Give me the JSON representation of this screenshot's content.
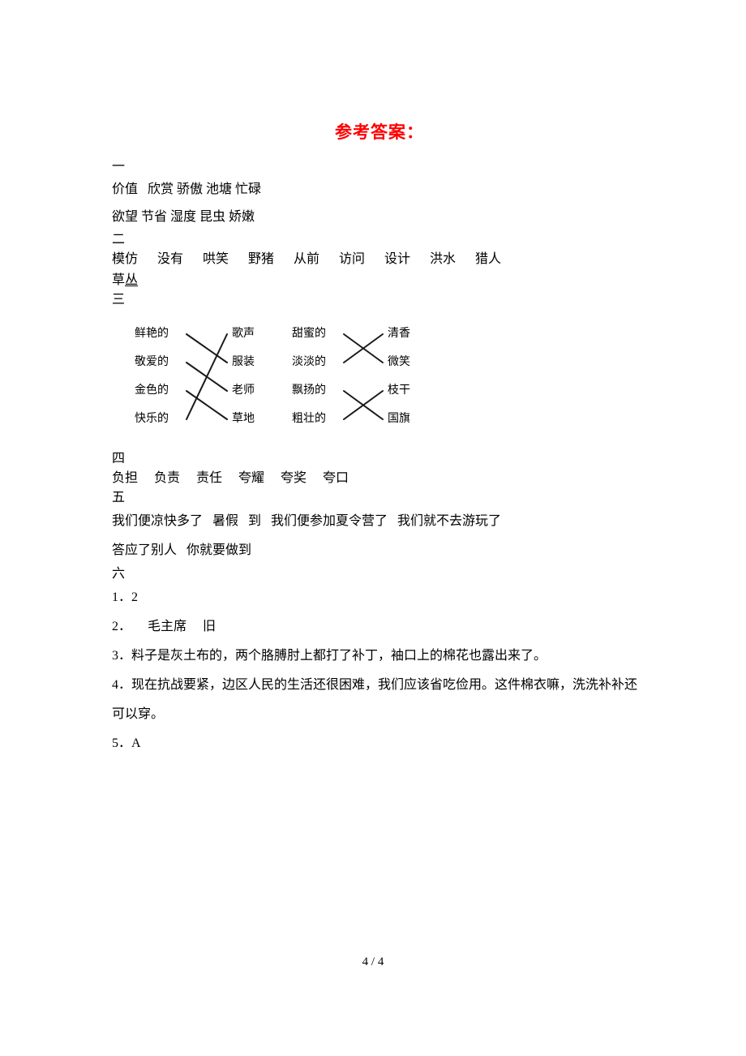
{
  "document": {
    "title": "参考答案：",
    "title_color": "#ff0000",
    "footer": "4 / 4"
  },
  "sections": {
    "one": {
      "number": "一",
      "line1": "价值   欣赏 骄傲 池塘 忙碌",
      "line2": "欲望 节省 湿度 昆虫 娇嫩"
    },
    "two": {
      "number": "二",
      "line1": "模仿      没有      哄笑      野猪      从前      访问      设计      洪水      猎人",
      "line2_prefix": "草",
      "line2_underlined": "丛"
    },
    "three": {
      "number": "三",
      "left_group": {
        "left_items": [
          "鲜艳的",
          "敬爱的",
          "金色的",
          "快乐的"
        ],
        "right_items": [
          "歌声",
          "服装",
          "老师",
          "草地"
        ],
        "connections": [
          {
            "from": 0,
            "to": 1
          },
          {
            "from": 1,
            "to": 2
          },
          {
            "from": 2,
            "to": 3
          },
          {
            "from": 3,
            "to": 0
          }
        ]
      },
      "right_group": {
        "left_items": [
          "甜蜜的",
          "淡淡的",
          "飘扬的",
          "粗壮的"
        ],
        "right_items": [
          "清香",
          "微笑",
          "枝干",
          "国旗"
        ],
        "connections": [
          {
            "from": 0,
            "to": 1
          },
          {
            "from": 1,
            "to": 0
          },
          {
            "from": 2,
            "to": 3
          },
          {
            "from": 3,
            "to": 2
          }
        ]
      }
    },
    "four": {
      "number": "四",
      "line1": "负担     负责     责任     夸耀     夸奖     夸口"
    },
    "five": {
      "number": "五",
      "line1": "我们便凉快多了   暑假   到   我们便参加夏令营了   我们就不去游玩了",
      "line2": "答应了别人   你就要做到"
    },
    "six": {
      "number": "六",
      "items": [
        "1．2",
        "2．     毛主席     旧",
        "3．料子是灰土布的，两个胳膊肘上都打了补丁，袖口上的棉花也露出来了。",
        "4．现在抗战要紧，边区人民的生活还很困难，我们应该省吃俭用。这件棉衣嘛，洗洗补补还可以穿。",
        "5．A"
      ]
    }
  }
}
